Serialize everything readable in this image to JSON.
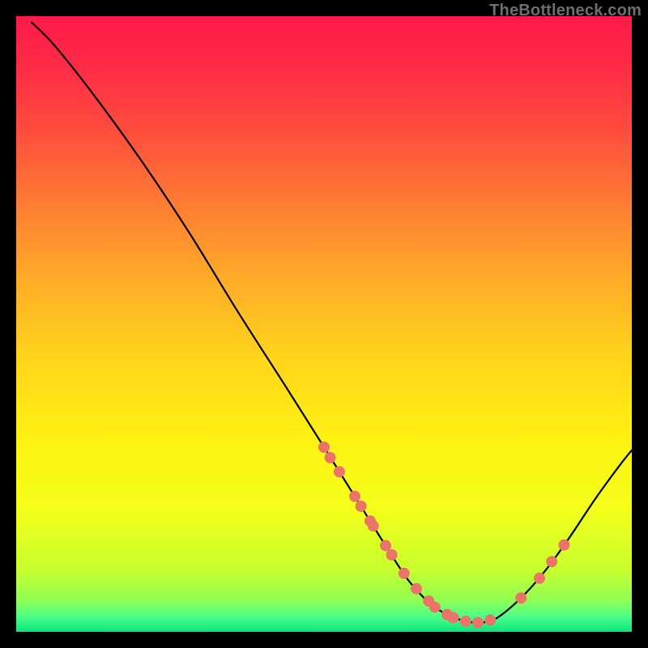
{
  "watermark": "TheBottleneck.com",
  "colors": {
    "background_black": "#000000",
    "curve_black": "#000000",
    "marker_coral": "#eb7469",
    "gradient_stops": [
      {
        "offset": 0.0,
        "color": "#ff1a4a"
      },
      {
        "offset": 0.08,
        "color": "#ff2b46"
      },
      {
        "offset": 0.18,
        "color": "#ff4a3e"
      },
      {
        "offset": 0.3,
        "color": "#ff7a34"
      },
      {
        "offset": 0.42,
        "color": "#ffa928"
      },
      {
        "offset": 0.55,
        "color": "#ffd31c"
      },
      {
        "offset": 0.68,
        "color": "#fff014"
      },
      {
        "offset": 0.8,
        "color": "#f4ff1a"
      },
      {
        "offset": 0.9,
        "color": "#c7ff2e"
      },
      {
        "offset": 0.95,
        "color": "#8fff55"
      },
      {
        "offset": 0.975,
        "color": "#4dff8a"
      },
      {
        "offset": 1.0,
        "color": "#08e57a"
      }
    ]
  },
  "chart_data": {
    "type": "line",
    "title": "",
    "xlabel": "",
    "ylabel": "",
    "xlim": [
      0,
      100
    ],
    "ylim": [
      0,
      100
    ],
    "grid": false,
    "curve": [
      {
        "x": 2.5,
        "y": 99.0
      },
      {
        "x": 6.0,
        "y": 95.5
      },
      {
        "x": 12.0,
        "y": 88.0
      },
      {
        "x": 20.0,
        "y": 77.0
      },
      {
        "x": 28.0,
        "y": 65.0
      },
      {
        "x": 36.0,
        "y": 52.0
      },
      {
        "x": 44.0,
        "y": 39.5
      },
      {
        "x": 50.0,
        "y": 30.0
      },
      {
        "x": 55.0,
        "y": 22.0
      },
      {
        "x": 60.0,
        "y": 14.0
      },
      {
        "x": 64.0,
        "y": 8.0
      },
      {
        "x": 68.0,
        "y": 4.0
      },
      {
        "x": 72.0,
        "y": 2.0
      },
      {
        "x": 75.0,
        "y": 1.5
      },
      {
        "x": 78.0,
        "y": 2.2
      },
      {
        "x": 82.0,
        "y": 5.5
      },
      {
        "x": 86.0,
        "y": 10.0
      },
      {
        "x": 90.0,
        "y": 15.5
      },
      {
        "x": 94.0,
        "y": 21.5
      },
      {
        "x": 98.0,
        "y": 27.0
      },
      {
        "x": 100.0,
        "y": 29.5
      }
    ],
    "markers": [
      {
        "x": 50.0,
        "y": 30.0
      },
      {
        "x": 51.0,
        "y": 28.3
      },
      {
        "x": 52.5,
        "y": 26.0
      },
      {
        "x": 55.0,
        "y": 22.0
      },
      {
        "x": 56.0,
        "y": 20.4
      },
      {
        "x": 57.5,
        "y": 18.0
      },
      {
        "x": 58.0,
        "y": 17.2
      },
      {
        "x": 60.0,
        "y": 14.0
      },
      {
        "x": 61.0,
        "y": 12.5
      },
      {
        "x": 63.0,
        "y": 9.5
      },
      {
        "x": 65.0,
        "y": 7.0
      },
      {
        "x": 67.0,
        "y": 5.0
      },
      {
        "x": 68.0,
        "y": 4.0
      },
      {
        "x": 70.0,
        "y": 2.8
      },
      {
        "x": 71.0,
        "y": 2.3
      },
      {
        "x": 73.0,
        "y": 1.7
      },
      {
        "x": 75.0,
        "y": 1.5
      },
      {
        "x": 77.0,
        "y": 1.9
      },
      {
        "x": 82.0,
        "y": 5.5
      },
      {
        "x": 85.0,
        "y": 8.7
      },
      {
        "x": 87.0,
        "y": 11.4
      },
      {
        "x": 89.0,
        "y": 14.1
      }
    ]
  }
}
